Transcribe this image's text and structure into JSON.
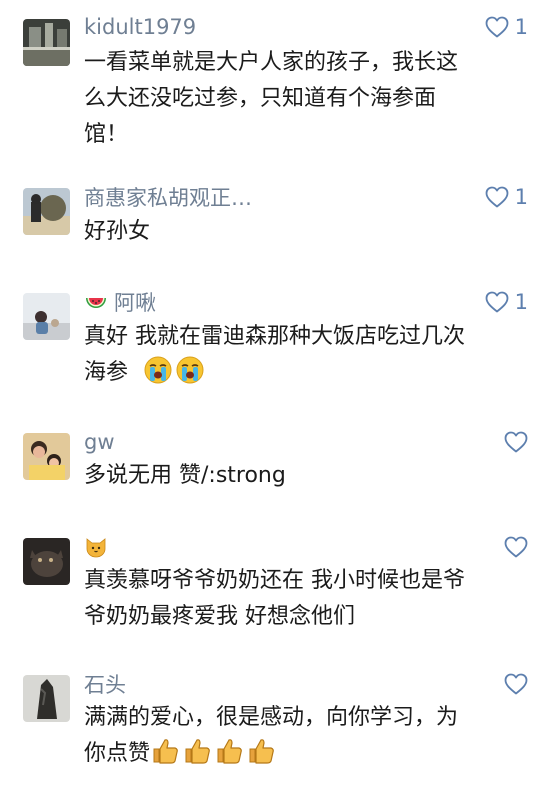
{
  "comments": [
    {
      "name": "kidult1979",
      "likes": "1",
      "content": [
        "一看菜单就是大户人家的孩子，我长这",
        "么大还没吃过参，只知道有个海参面",
        "馆！"
      ]
    },
    {
      "name": "商惠家私胡观正…",
      "likes": "1",
      "content": [
        "好孙女"
      ]
    },
    {
      "name": "阿啾",
      "name_emoji": "watermelon-icon",
      "likes": "1",
      "content": [
        "真好 我就在雷迪森那种大饭店吃过几次",
        "海参"
      ],
      "content_emojis": [
        "crying-face-icon",
        "crying-face-icon"
      ]
    },
    {
      "name": "gw",
      "likes": "",
      "content": [
        "多说无用 赞/:strong"
      ]
    },
    {
      "name": "",
      "name_emoji": "cat-face-icon",
      "likes": "",
      "content": [
        "真羡慕呀爷爷奶奶还在 我小时候也是爷",
        "爷奶奶最疼爱我 好想念他们"
      ]
    },
    {
      "name": "石头",
      "likes": "",
      "content": [
        "满满的爱心，很是感动，向你学习，为",
        "你点赞"
      ],
      "content_emojis": [
        "thumbs-up-icon",
        "thumbs-up-icon",
        "thumbs-up-icon",
        "thumbs-up-icon"
      ]
    }
  ],
  "colors": {
    "name": "#6f7f93",
    "like": "#5d7fae",
    "text": "#1b1b1b"
  }
}
